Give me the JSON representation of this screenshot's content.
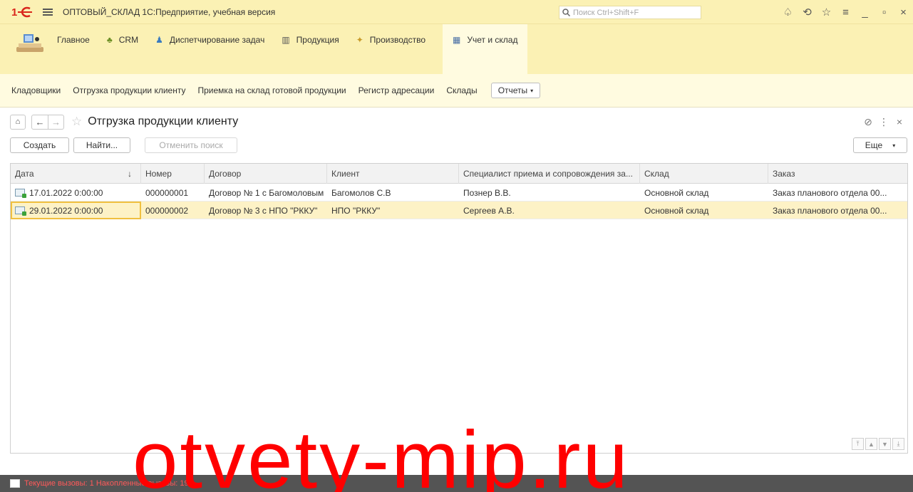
{
  "app": {
    "title": "ОПТОВЫЙ_СКЛАД 1С:Предприятие, учебная версия",
    "search_placeholder": "Поиск Ctrl+Shift+F",
    "logo_text": "1С",
    "accent_color": "#fbf1b4",
    "logo_color": "#d9261c"
  },
  "sections": [
    {
      "label": "Главное",
      "icon": "home-desk-icon"
    },
    {
      "label": "CRM",
      "icon": "people-icon"
    },
    {
      "label": "Диспетчирование задач",
      "icon": "users-icon"
    },
    {
      "label": "Продукция",
      "icon": "catalog-icon"
    },
    {
      "label": "Производство",
      "icon": "factory-icon"
    },
    {
      "label": "Учет и склад",
      "icon": "table-icon",
      "active": true
    }
  ],
  "functions": {
    "items": [
      "Кладовщики",
      "Отгрузка продукции клиенту",
      "Приемка на склад готовой продукции",
      "Регистр адресации",
      "Склады"
    ],
    "reports_label": "Отчеты"
  },
  "form": {
    "title": "Отгрузка продукции клиенту",
    "create_label": "Создать",
    "find_label": "Найти...",
    "cancel_search_label": "Отменить поиск",
    "more_label": "Еще"
  },
  "table": {
    "columns": [
      "Дата",
      "Номер",
      "Договор",
      "Клиент",
      "Специалист приема и сопровождения за...",
      "Склад",
      "Заказ"
    ],
    "sort_indicator": "↓",
    "rows": [
      {
        "date": "17.01.2022 0:00:00",
        "number": "000000001",
        "contract": "Договор № 1 с Багомоловым",
        "client": "Багомолов С.В",
        "specialist": "Познер В.В.",
        "warehouse": "Основной склад",
        "order": "Заказ планового отдела 00..."
      },
      {
        "date": "29.01.2022 0:00:00",
        "number": "000000002",
        "contract": "Договор № 3 с НПО \"РККУ\"",
        "client": "НПО \"РККУ\"",
        "specialist": "Сергеев А.В.",
        "warehouse": "Основной склад",
        "order": "Заказ планового отдела 00...",
        "selected": true
      }
    ]
  },
  "status": {
    "text": "Текущие вызовы: 1   Накопленные вызовы: 19"
  },
  "watermark": "otvety-mip.ru"
}
